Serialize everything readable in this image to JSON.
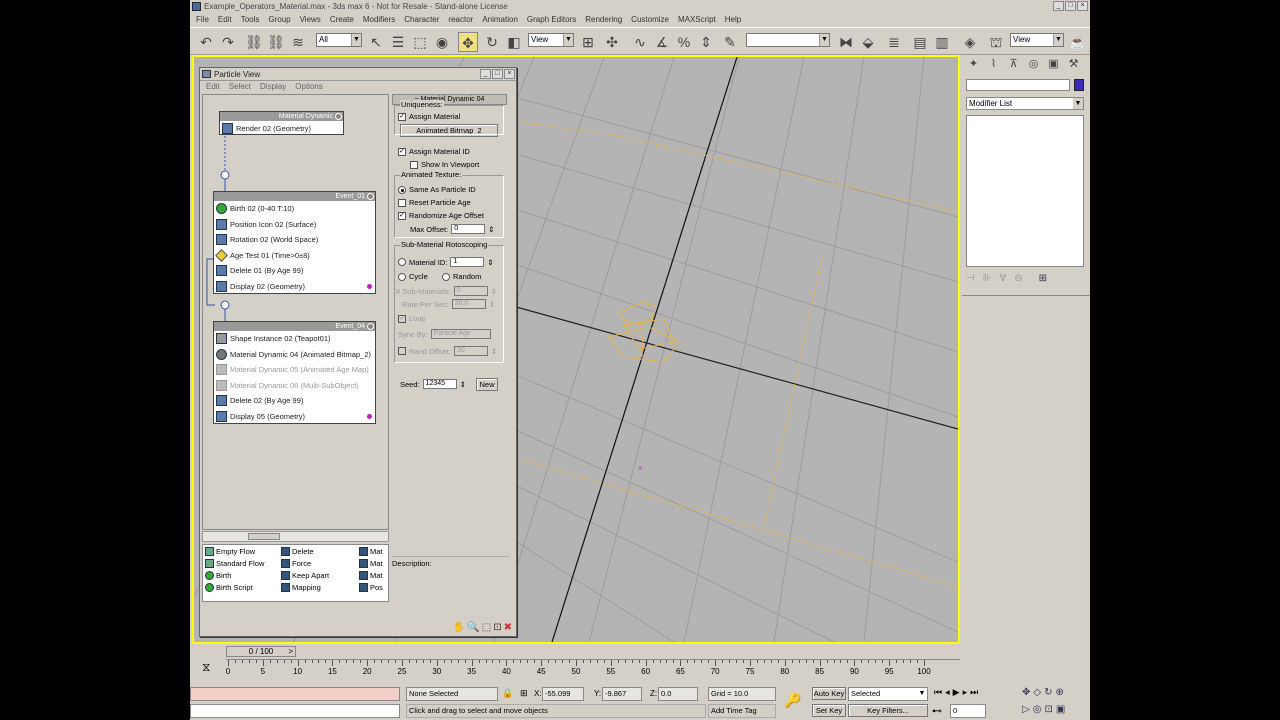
{
  "window": {
    "title": "Example_Operators_Material.max - 3ds max 6 - Not for Resale - Stand-alone License"
  },
  "menu": [
    "File",
    "Edit",
    "Tools",
    "Group",
    "Views",
    "Create",
    "Modifiers",
    "Character",
    "reactor",
    "Animation",
    "Graph Editors",
    "Rendering",
    "Customize",
    "MAXScript",
    "Help"
  ],
  "toolbar": {
    "selection_filter": "All",
    "ref_coord": "View",
    "ref_coord2": "View",
    "named_sel": ""
  },
  "particle_view": {
    "title": "Particle View",
    "menu": [
      "Edit",
      "Select",
      "Display",
      "Options"
    ],
    "global_event": {
      "title": "Material Dynamic",
      "ops": [
        "Render 02 (Geometry)"
      ]
    },
    "event1": {
      "title": "Event_01",
      "ops": [
        "Birth 02 (0-40 T:10)",
        "Position Icon 02 (Surface)",
        "Rotation 02 (World Space)",
        "Age Test 01 (Time>0±8)",
        "Delete 01 (By Age 99)",
        "Display 02 (Geometry)"
      ]
    },
    "event2": {
      "title": "Event_04",
      "ops": [
        "Shape Instance 02 (Teapot01)",
        "Material Dynamic 04 (Animated Bitmap_2)",
        "Material Dynamic 05 (Animated Age Map)",
        "Material Dynamic 06 (Multi-SubObject)",
        "Delete 02 (By Age 99)",
        "Display 05 (Geometry)"
      ]
    },
    "depot": [
      "Empty Flow",
      "Standard Flow",
      "Birth",
      "Birth Script",
      "Delete",
      "Force",
      "Keep Apart",
      "Mapping",
      "Mat",
      "Mat",
      "Mat",
      "Pos"
    ],
    "description_label": "Description:"
  },
  "params": {
    "rollout_title": "Material Dynamic 04",
    "assign_material": "Assign Material",
    "material_button": "Animated Bitmap_2",
    "assign_material_id": "Assign Material ID",
    "show_in_viewport": "Show In Viewport",
    "animated_texture": "Animated Texture:",
    "same_as_particle_id": "Same As Particle ID",
    "reset_particle_age": "Reset Particle Age",
    "randomize_age_offset": "Randomize Age Offset",
    "max_offset_label": "Max Offset:",
    "max_offset": "0",
    "sub_material_roto": "Sub-Material Rotoscoping",
    "material_id_label": "Material ID:",
    "material_id": "1",
    "cycle": "Cycle",
    "random": "Random",
    "num_sub_materials_label": "# Sub-Materials:",
    "num_sub_materials": "0",
    "rate_per_sec_label": "Rate Per Sec:",
    "rate_per_sec": "30.0",
    "loop": "Loop",
    "sync_by_label": "Sync By:",
    "sync_by": "Particle Age",
    "rand_offset_label": "Rand Offset:",
    "rand_offset": "30",
    "uniqueness": "Uniqueness:",
    "seed_label": "Seed:",
    "seed": "12345",
    "new_button": "New"
  },
  "command_panel": {
    "modifier_list": "Modifier List"
  },
  "timeline": {
    "frame": "0 / 100",
    "ticks": [
      "0",
      "5",
      "10",
      "15",
      "20",
      "25",
      "30",
      "35",
      "40",
      "45",
      "50",
      "55",
      "60",
      "65",
      "70",
      "75",
      "80",
      "85",
      "90",
      "95",
      "100"
    ]
  },
  "status": {
    "selection": "None Selected",
    "prompt": "Click and drag to select and move objects",
    "x_label": "X:",
    "x": "-55.099",
    "y_label": "Y:",
    "y": "-9.867",
    "z_label": "Z:",
    "z": "0.0",
    "grid": "Grid = 10.0",
    "add_time_tag": "Add Time Tag",
    "auto_key": "Auto Key",
    "set_key": "Set Key",
    "key_mode": "Selected",
    "key_filters": "Key Filters...",
    "current_frame": "0"
  }
}
